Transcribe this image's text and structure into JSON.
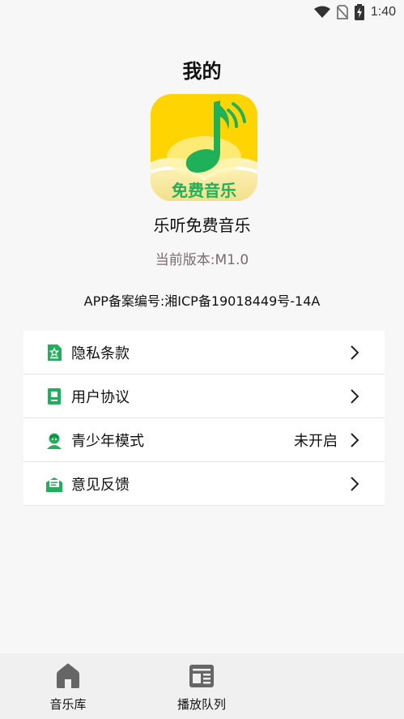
{
  "status_bar": {
    "time": "1:40",
    "icons": [
      "wifi-icon",
      "no-sim-icon",
      "battery-charging-icon"
    ]
  },
  "header": {
    "title": "我的"
  },
  "app_info": {
    "logo_text": "免费音乐",
    "name": "乐听免费音乐",
    "version": "当前版本:M1.0",
    "icp_record": "APP备案编号:湘ICP备19018449号-14A"
  },
  "menu": {
    "items": [
      {
        "label": "隐私条款",
        "icon": "privacy-doc-icon",
        "status": ""
      },
      {
        "label": "用户协议",
        "icon": "user-agreement-icon",
        "status": ""
      },
      {
        "label": "青少年模式",
        "icon": "teen-mode-icon",
        "status": "未开启"
      },
      {
        "label": "意见反馈",
        "icon": "feedback-icon",
        "status": ""
      }
    ]
  },
  "bottom_nav": {
    "items": [
      {
        "label": "音乐库",
        "icon": "home-icon"
      },
      {
        "label": "播放队列",
        "icon": "queue-icon"
      }
    ]
  },
  "colors": {
    "accent_green": "#1fb15a",
    "logo_yellow": "#ffd400",
    "version_gray": "#7a6b70"
  }
}
